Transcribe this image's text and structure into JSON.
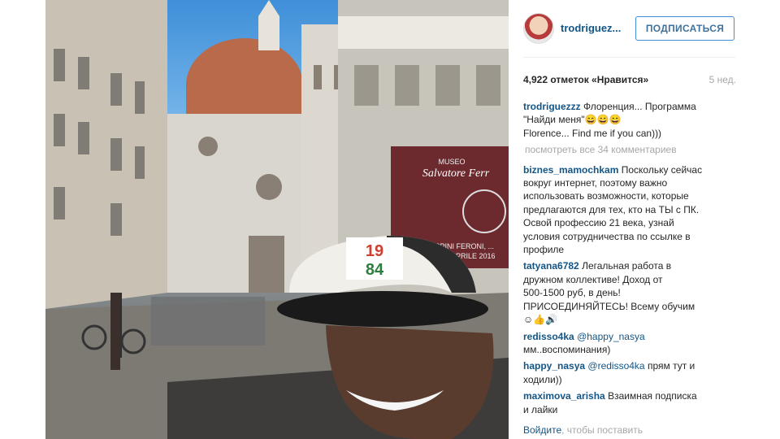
{
  "post": {
    "username": "trodriguez...",
    "follow_label": "ПОДПИСАТЬСЯ",
    "likes": "4,922 отметок «Нравится»",
    "age": "5 нед.",
    "view_all_comments": "посмотреть все 34 комментариев",
    "login_link": "Войдите",
    "login_rest": ", чтобы поставить"
  },
  "photo": {
    "sign_line1": "MUSEO",
    "sign_line2": "Salvatore Ferr",
    "sign_line3": "LAZZO SPINI FERONI, ...",
    "sign_line4": "- 3 APRILE 2016",
    "cap_number_top": "19",
    "cap_number_bottom": "84"
  },
  "comments": [
    {
      "user": "trodriguezzz",
      "lines": [
        "Флоренция... Программа",
        "\"Найди меня\"😄😄😄",
        "Florence... Find me if you can)))"
      ]
    },
    {
      "user": "biznes_mamochkam",
      "lines": [
        "Поскольку сейчас",
        "вокруг интернет, поэтому важно",
        "использовать возможности, которые",
        "предлагаются для тех, кто на ТЫ с ПК.",
        "Освой профессию 21 века, узнай",
        "условия сотрудничества по ссылке в",
        "профиле"
      ]
    },
    {
      "user": "tatyana6782",
      "lines": [
        "Легальная работа в",
        "дружном коллективе! Доход от",
        "500-1500 руб, в день!",
        "ПРИСОЕДИНЯЙТЕСЬ! Всему обучим",
        "☺👍🔊"
      ]
    },
    {
      "user": "redisso4ka",
      "mention": "@happy_nasya",
      "lines": [
        "мм..воспоминания)"
      ]
    },
    {
      "user": "happy_nasya",
      "mention": "@redisso4ka",
      "lines": [
        "прям тут и",
        "ходили))"
      ]
    },
    {
      "user": "maximova_arisha",
      "lines": [
        "Взаимная подписка",
        "и лайки"
      ]
    }
  ]
}
